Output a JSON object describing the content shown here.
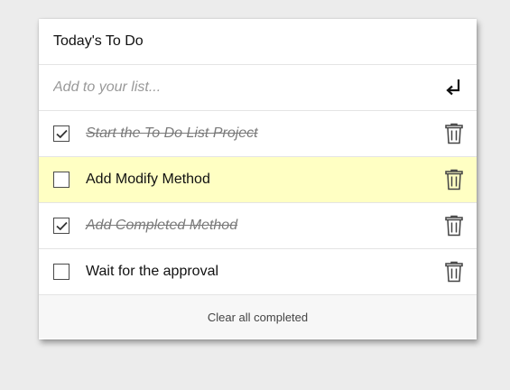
{
  "header": {
    "title": "Today's To Do"
  },
  "add": {
    "placeholder": "Add to your list...",
    "enter_icon": "enter-return-icon"
  },
  "items": [
    {
      "text": "Start the To Do List Project",
      "completed": true
    },
    {
      "text": "Add Modify Method",
      "completed": false,
      "highlighted": true
    },
    {
      "text": "Add Completed Method",
      "completed": true
    },
    {
      "text": "Wait for the approval",
      "completed": false
    }
  ],
  "footer": {
    "clear_label": "Clear all completed"
  },
  "colors": {
    "highlight": "#ffffc3",
    "background": "#ececec",
    "done_text": "#7a7a7a"
  }
}
